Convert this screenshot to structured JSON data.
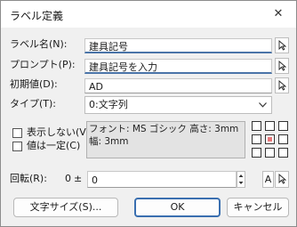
{
  "dialog": {
    "title": "ラベル定義",
    "close_glyph": "✕"
  },
  "labels": {
    "label_name": "ラベル名(N):",
    "prompt": "プロンプト(P):",
    "initial_value": "初期値(D):",
    "type": "タイプ(T):",
    "hide": "表示しない(V)",
    "constant": "値は一定(C)",
    "rotation": "回転(R):"
  },
  "fields": {
    "label_name": "建具記号",
    "prompt": "建具記号を入力",
    "initial_value": "AD",
    "type": "0:文字列",
    "rotation": "0"
  },
  "font_info": "フォント: MS ゴシック 高さ: 3mm 幅: 3mm",
  "rotation_controls": {
    "value_prefix": "0",
    "plus_minus": "±",
    "text_button": "A"
  },
  "buttons": {
    "text_size": "文字サイズ(S)...",
    "ok": "OK",
    "cancel": "キャンセル"
  },
  "alignment": {
    "selected_cell": "middle-center",
    "selected_color": "#e8787a"
  },
  "colors": {
    "accent_underline": "#4a74a8"
  }
}
